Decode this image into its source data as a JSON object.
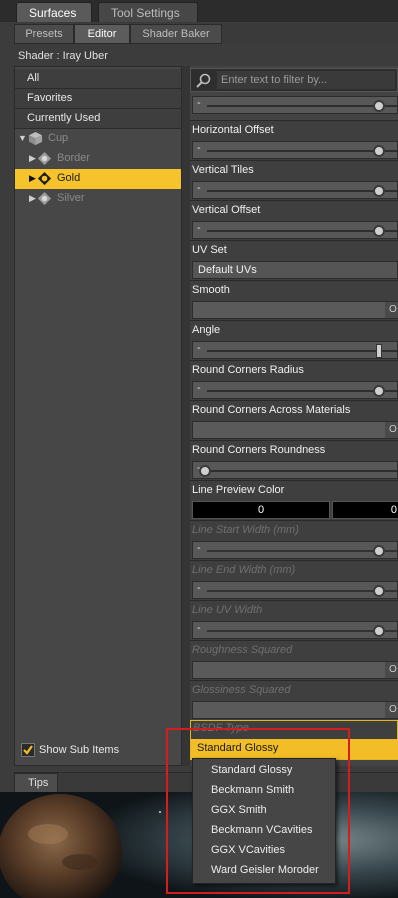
{
  "tabs": {
    "surfaces": "Surfaces",
    "tool_settings": "Tool Settings"
  },
  "subtabs": {
    "presets": "Presets",
    "editor": "Editor",
    "shader_baker": "Shader Baker"
  },
  "shader_label": "Shader : Iray Uber",
  "categories": [
    "All",
    "Favorites",
    "Currently Used"
  ],
  "tree": {
    "root": "Cup",
    "items": [
      {
        "label": "Border",
        "selected": false
      },
      {
        "label": "Gold",
        "selected": true
      },
      {
        "label": "Silver",
        "selected": false
      }
    ]
  },
  "show_sub_items": {
    "label": "Show Sub Items",
    "checked": true
  },
  "filter": {
    "placeholder": "Enter text to filter by..."
  },
  "properties": {
    "horizontal_offset": "Horizontal Offset",
    "vertical_tiles": "Vertical Tiles",
    "vertical_offset": "Vertical Offset",
    "uv_set": "UV Set",
    "uv_set_value": "Default UVs",
    "smooth": "Smooth",
    "toggle_value": "O",
    "angle": "Angle",
    "round_corners_radius": "Round Corners Radius",
    "round_corners_across": "Round Corners Across Materials",
    "round_corners_roundness": "Round Corners Roundness",
    "line_preview_color": "Line Preview Color",
    "color_r": "0",
    "color_g": "0",
    "line_start_width": "Line Start Width (mm)",
    "line_end_width": "Line End Width (mm)",
    "line_uv_width": "Line UV Width",
    "roughness_squared": "Roughness Squared",
    "glossiness_squared": "Glossiness Squared",
    "bsdf_type": "BSDF Type",
    "bsdf_value": "Standard Glossy"
  },
  "dropdown_options": [
    "Standard Glossy",
    "Beckmann Smith",
    "GGX Smith",
    "Beckmann VCavities",
    "GGX VCavities",
    "Ward Geisler Moroder"
  ],
  "tips_tab": "Tips",
  "colors": {
    "accent": "#f2bd27",
    "highlight": "#d51d1d"
  }
}
